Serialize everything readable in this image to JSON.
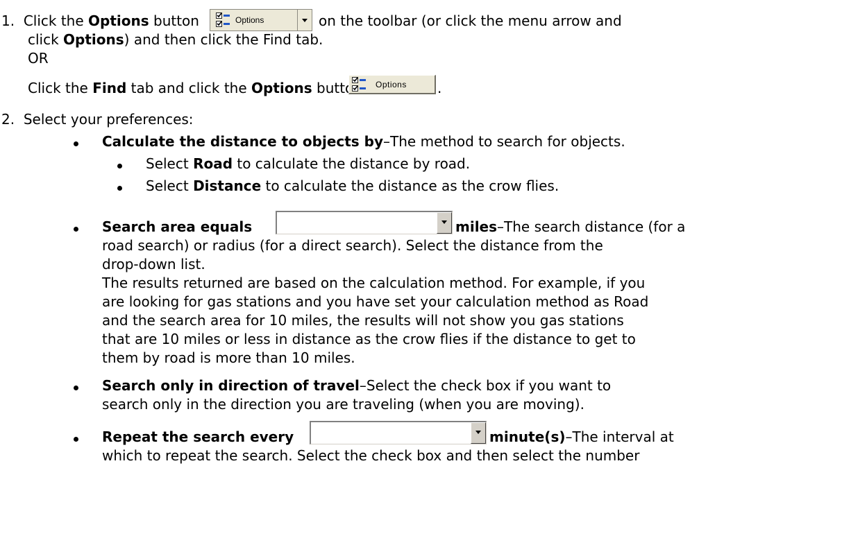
{
  "step1": {
    "number": "1.",
    "prefix": "Click the",
    "options_word": "Options",
    "button": "button",
    "after_button": "on the toolbar (or click the menu arrow and",
    "line2_prefix": "click",
    "line2_options": "Options",
    "line2_suffix": ") and then click the Find tab.",
    "or": "OR",
    "alt_prefix": "Click the",
    "alt_find": "Find",
    "alt_middle": "tab and click the",
    "alt_options": "Options",
    "alt_button": "button",
    "alt_period": "."
  },
  "toolbar_button": {
    "label": "Options",
    "icon": "checklist-icon",
    "arrow_icon": "dropdown-arrow-icon"
  },
  "find_tab_button": {
    "label": "Options",
    "icon": "checklist-icon"
  },
  "step2": {
    "number": "2.",
    "text": "Select your preferences:"
  },
  "pref_calc": {
    "title": "Calculate the distance to objects by",
    "desc": "–The method to search for objects.",
    "road_prefix": "Select",
    "road_word": "Road",
    "road_suffix": "to calculate the distance by road.",
    "dist_prefix": "Select",
    "dist_word": "Distance",
    "dist_suffix": "to calculate the distance as the crow flies."
  },
  "pref_area": {
    "title": "Search area equals",
    "unit": "miles",
    "desc1": "–The search distance (for a",
    "desc2": "road search) or radius (for a direct search). Select the distance from the",
    "desc3": "drop-down list.",
    "note1": "The results returned are based on the calculation method. For example, if you",
    "note2": "are looking for gas stations and you have set your calculation method as Road",
    "note3": "and the search area for 10 miles, the results will not show you gas stations",
    "note4": "that are 10 miles or less in distance as the crow flies if the distance to get to",
    "note5": "them by road is more than 10 miles.",
    "combo_value": ""
  },
  "pref_direction": {
    "title": "Search only in direction of travel",
    "desc1": "–Select the check box if you want to",
    "desc2": "search only in the direction you are traveling (when you are moving)."
  },
  "pref_repeat": {
    "title": "Repeat the search every",
    "unit": "minute(s)",
    "desc1": "–The interval at",
    "desc2": "which to repeat the search. Select the check box and then select the number",
    "combo_value": ""
  }
}
